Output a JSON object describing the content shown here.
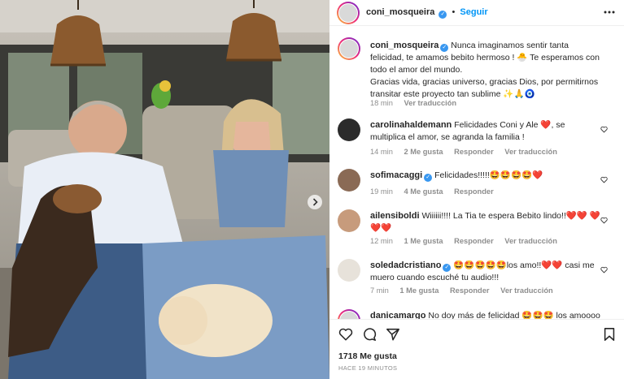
{
  "post": {
    "author": "coni_mosqueira",
    "follow_label": "Seguir",
    "more_icon": "more-horizontal-icon",
    "caption": "Nunca imaginamos sentir tanta felicidad, te amamos bebito hermoso ! 🐣 Te esperamos con todo el amor del mundo.",
    "caption2": "Gracias vida, gracias universo, gracias Dios, por permitirnos transitar este proyecto tan sublime ✨🙏🧿",
    "caption_time": "18 min",
    "see_translation": "Ver traducción",
    "likes": "1718 Me gusta",
    "time_ago": "HACE 19 MINUTOS"
  },
  "comments": [
    {
      "user": "carolinahaldemann",
      "verified": false,
      "text": "Felicidades Coni y Ale ❤️, se multiplica el amor, se agranda la familia !",
      "time": "14 min",
      "likes": "2 Me gusta",
      "reply": "Responder",
      "translate": "Ver traducción"
    },
    {
      "user": "sofimacaggi",
      "verified": true,
      "text": "Felicidades!!!!!🤩🤩🤩🤩❤️",
      "time": "19 min",
      "likes": "4 Me gusta",
      "reply": "Responder",
      "translate": ""
    },
    {
      "user": "ailensiboldi",
      "verified": false,
      "text": "Wiiiiii!!!! La Tia te espera Bebito lindo!!❤️❤️ ❤️ ❤️❤️",
      "time": "12 min",
      "likes": "1 Me gusta",
      "reply": "Responder",
      "translate": "Ver traducción"
    },
    {
      "user": "soledadcristiano",
      "verified": true,
      "text": "🤩🤩🤩🤩🤩los amo!!❤️❤️ casi me muero cuando escuché tu audio!!!",
      "time": "7 min",
      "likes": "1 Me gusta",
      "reply": "Responder",
      "translate": "Ver traducción"
    },
    {
      "user": "danicamargo",
      "verified": false,
      "text": "No doy más de felicidad 🤩🤩🤩 los amoooo",
      "time": "",
      "likes": "",
      "reply": "",
      "translate": ""
    }
  ],
  "colors": {
    "accent": "#0095f6",
    "verified": "#3897f0",
    "heart": "#ed4956"
  },
  "icons": [
    "heart-icon",
    "comment-icon",
    "share-icon",
    "bookmark-icon",
    "next-arrow-icon"
  ]
}
